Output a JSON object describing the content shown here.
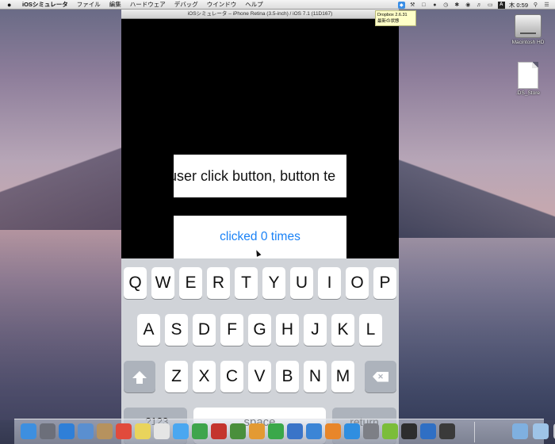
{
  "menubar": {
    "app_name": "iOSシミュレータ",
    "items": [
      "ファイル",
      "編集",
      "ハードウェア",
      "デバッグ",
      "ウインドウ",
      "ヘルプ"
    ],
    "clock": "木 0:59"
  },
  "dropbox_tooltip": {
    "line1": "Dropbox 2.6.31",
    "line2": "最新の状態"
  },
  "simulator": {
    "window_title": "iOSシミュレータ – iPhone Retina (3.5-inch) / iOS 7.1 (11D167)",
    "text_field_value": "user click button, button te",
    "button_label": "clicked 0 times"
  },
  "keyboard": {
    "row1": [
      "Q",
      "W",
      "E",
      "R",
      "T",
      "Y",
      "U",
      "I",
      "O",
      "P"
    ],
    "row2": [
      "A",
      "S",
      "D",
      "F",
      "G",
      "H",
      "J",
      "K",
      "L"
    ],
    "row3": [
      "Z",
      "X",
      "C",
      "V",
      "B",
      "N",
      "M"
    ],
    "numbers_key": ".?123",
    "space_key": "space",
    "return_key": "return"
  },
  "desktop": {
    "icons": [
      {
        "label": "Macintosh HD",
        "icon": "hard-drive-icon"
      },
      {
        "label": ".DS_Store",
        "icon": "document-icon"
      }
    ]
  },
  "dock": {
    "apps": [
      {
        "name": "finder-icon",
        "color": "#3d8fe0"
      },
      {
        "name": "launchpad-icon",
        "color": "#6c6f7a"
      },
      {
        "name": "safari-icon",
        "color": "#2f7fd8"
      },
      {
        "name": "mail-icon",
        "color": "#5a8fd0"
      },
      {
        "name": "contacts-icon",
        "color": "#b6925e"
      },
      {
        "name": "calendar-icon",
        "color": "#e14b3c"
      },
      {
        "name": "notes-icon",
        "color": "#e9d45c"
      },
      {
        "name": "reminders-icon",
        "color": "#e5e5e5"
      },
      {
        "name": "messages-icon",
        "color": "#4aa7f0"
      },
      {
        "name": "facetime-icon",
        "color": "#3fa54c"
      },
      {
        "name": "photobooth-icon",
        "color": "#c4352e"
      },
      {
        "name": "iphoto-icon",
        "color": "#4a8f3c"
      },
      {
        "name": "pages-icon",
        "color": "#e39a33"
      },
      {
        "name": "numbers-icon",
        "color": "#3aa84a"
      },
      {
        "name": "keynote-icon",
        "color": "#3a74c8"
      },
      {
        "name": "itunes-icon",
        "color": "#3b85d6"
      },
      {
        "name": "ibooks-icon",
        "color": "#e8862a"
      },
      {
        "name": "appstore-icon",
        "color": "#2f8ee0"
      },
      {
        "name": "preferences-icon",
        "color": "#7d7f86"
      },
      {
        "name": "textwrangler-icon",
        "color": "#7bbd3a"
      },
      {
        "name": "console-icon",
        "color": "#2d2d2d"
      },
      {
        "name": "xcode-icon",
        "color": "#2f6fc4"
      },
      {
        "name": "ios-simulator-icon",
        "color": "#3a3a3a"
      }
    ],
    "documents": [
      {
        "name": "downloads-folder-icon",
        "color": "#7fb0e0"
      },
      {
        "name": "documents-folder-icon",
        "color": "#9ec4e8"
      },
      {
        "name": "trash-icon",
        "color": "#c7c9cf"
      }
    ]
  }
}
